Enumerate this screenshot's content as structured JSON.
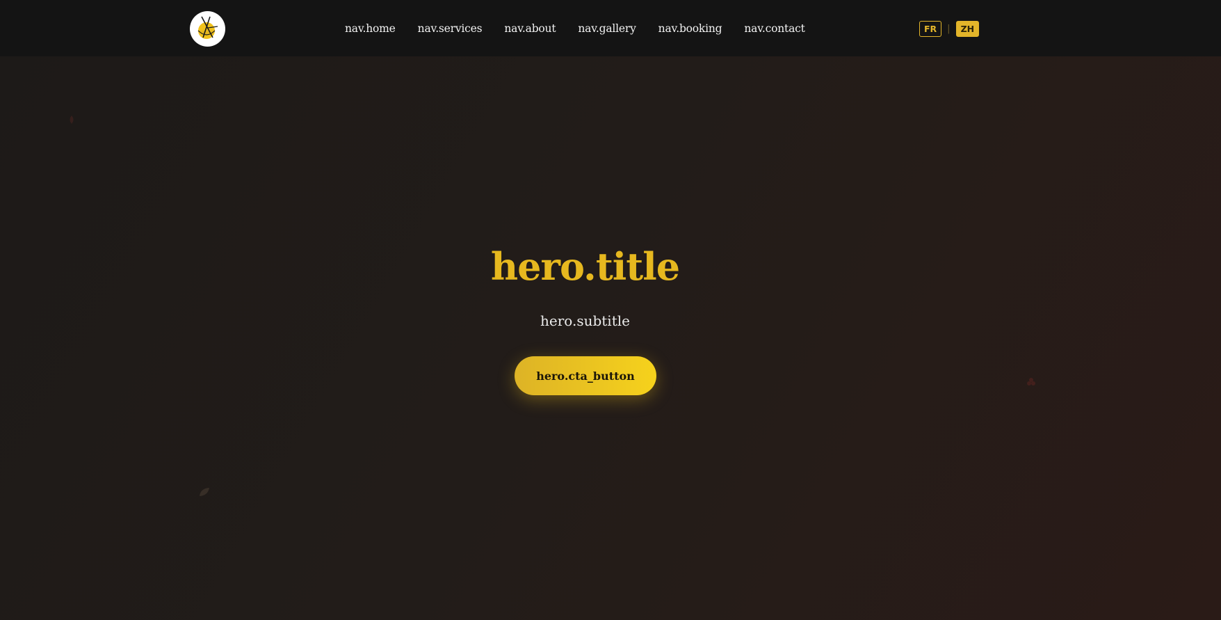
{
  "header": {
    "logo_icon": "restaurant-logo-chopsticks-bowl",
    "nav": [
      {
        "label": "nav.home"
      },
      {
        "label": "nav.services"
      },
      {
        "label": "nav.about"
      },
      {
        "label": "nav.gallery"
      },
      {
        "label": "nav.booking"
      },
      {
        "label": "nav.contact"
      }
    ],
    "languages": {
      "fr": "FR",
      "zh": "ZH",
      "selected": "ZH"
    }
  },
  "hero": {
    "title": "hero.title",
    "subtitle": "hero.subtitle",
    "cta_label": "hero.cta_button"
  },
  "colors": {
    "accent": "#e6b81f",
    "navbar_bg": "#141414",
    "hero_bg": "#221c19",
    "text_light": "#f2f2f2"
  }
}
